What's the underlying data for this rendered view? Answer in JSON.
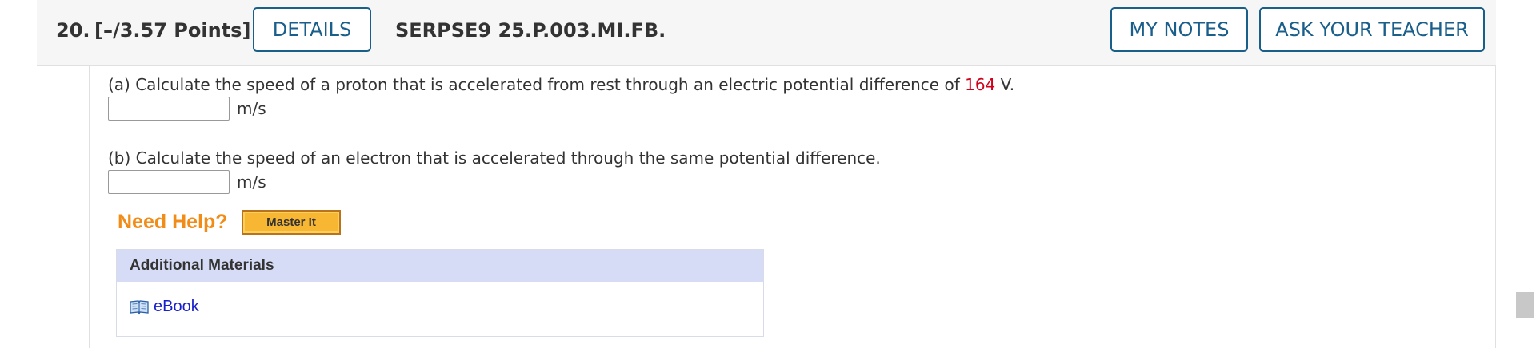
{
  "question": {
    "number": "20.",
    "points": "[–/3.57 Points]",
    "details_label": "DETAILS",
    "code": "SERPSE9 25.P.003.MI.FB.",
    "my_notes_label": "MY NOTES",
    "ask_teacher_label": "ASK YOUR TEACHER"
  },
  "part_a": {
    "prompt_before": "(a) Calculate the speed of a proton that is accelerated from rest through an electric potential difference of ",
    "value": "164",
    "prompt_after": " V.",
    "input_value": "",
    "unit": "m/s"
  },
  "part_b": {
    "prompt": "(b) Calculate the speed of an electron that is accelerated through the same potential difference.",
    "input_value": "",
    "unit": "m/s"
  },
  "help": {
    "need_help": "Need Help?",
    "master_it": "Master It"
  },
  "materials": {
    "title": "Additional Materials",
    "ebook": "eBook"
  },
  "colors": {
    "accent": "#1a5e8a",
    "highlight": "#d0021b",
    "help_orange": "#f28c18",
    "materials_header": "#d6dcf5",
    "link": "#1a1fcc"
  }
}
